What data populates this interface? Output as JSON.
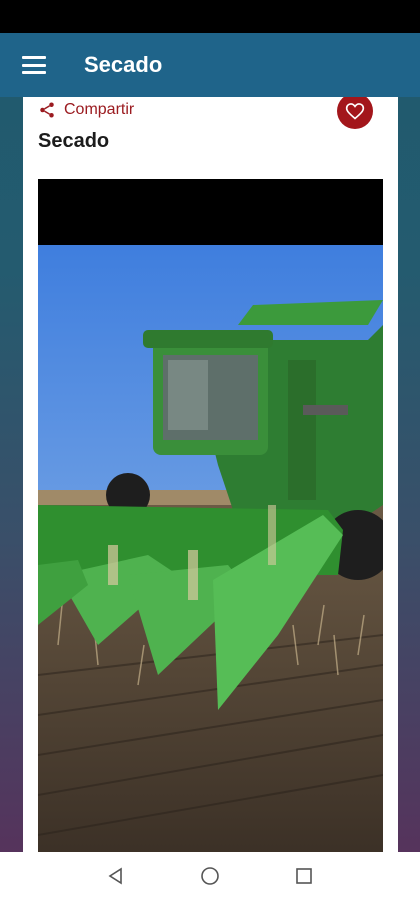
{
  "app_bar": {
    "title": "Secado",
    "menu_icon": "menu-icon"
  },
  "post": {
    "share_label": "Compartir",
    "share_icon": "share-icon",
    "favorite_icon": "heart-icon",
    "title": "Secado",
    "image_icon": "combine-harvester-photo"
  },
  "colors": {
    "app_bar": "#1f648a",
    "accent": "#a3161b",
    "share_text": "#9b1b20"
  },
  "nav": {
    "back": "back-icon",
    "home": "home-icon",
    "recents": "recents-icon"
  }
}
